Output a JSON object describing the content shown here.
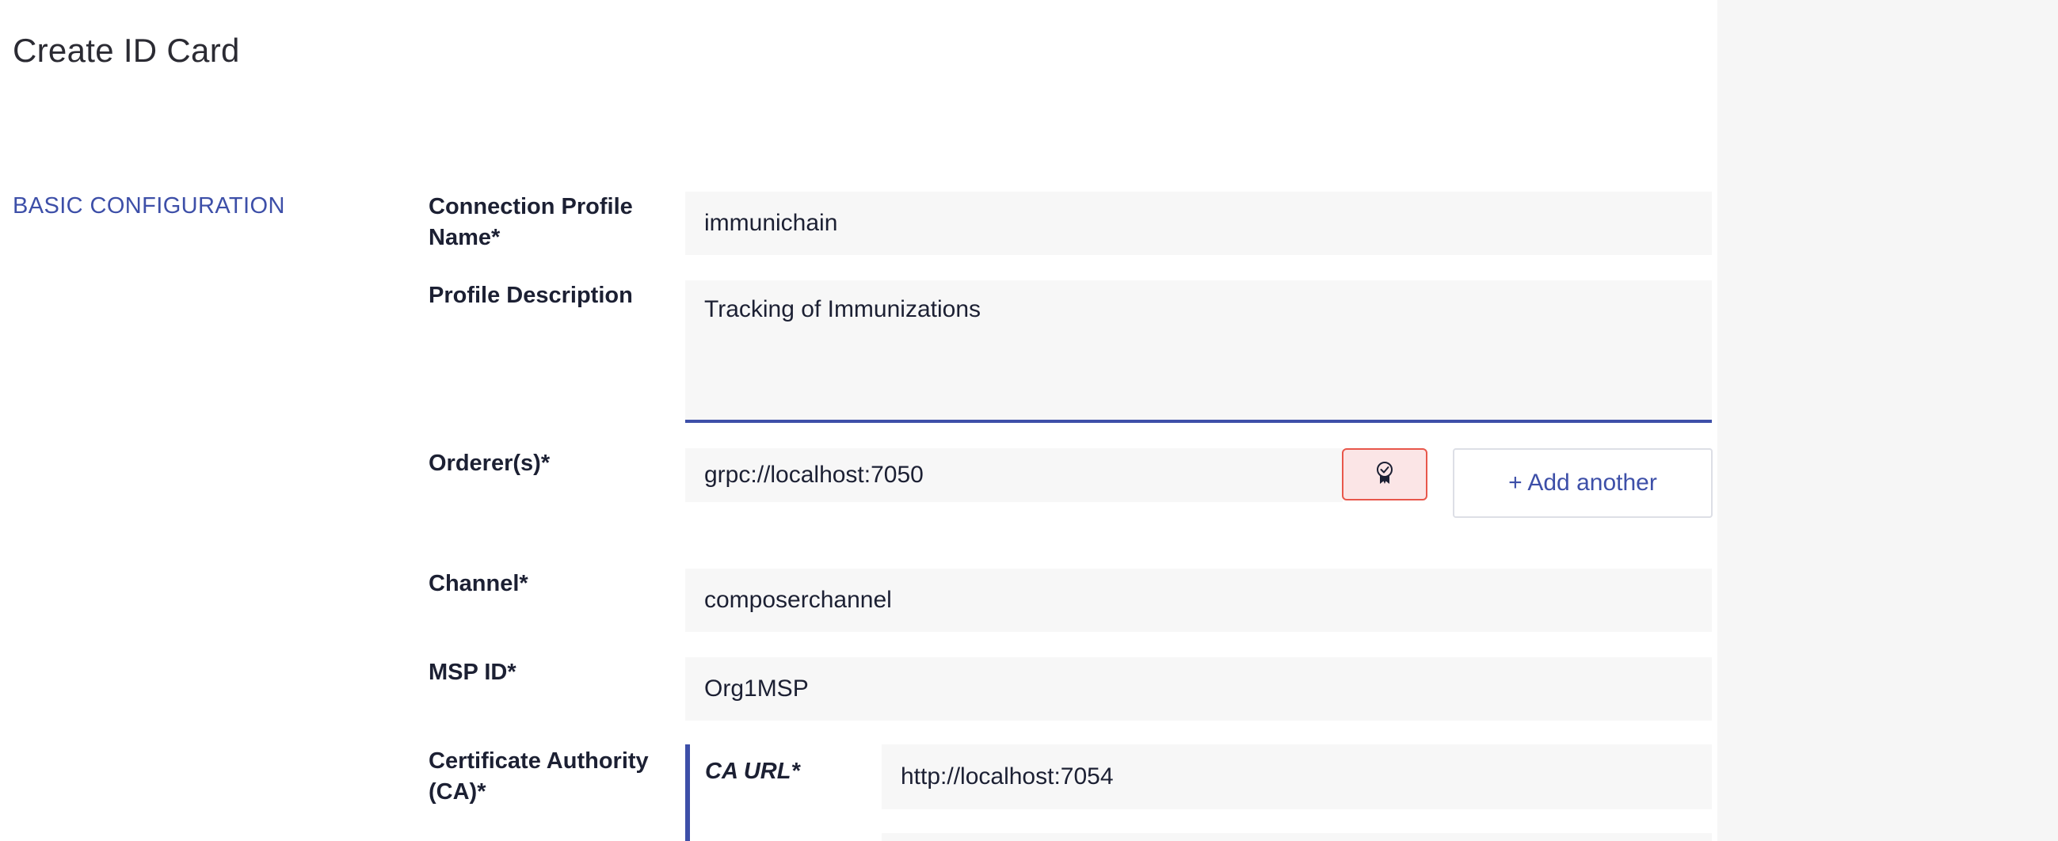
{
  "page": {
    "title": "Create ID Card"
  },
  "section": {
    "title": "BASIC CONFIGURATION"
  },
  "fields": {
    "profile_name": {
      "label": "Connection Profile Name*",
      "value": "immunichain"
    },
    "profile_description": {
      "label": "Profile Description",
      "value": "Tracking of Immunizations"
    },
    "orderers": {
      "label": "Orderer(s)*",
      "value": "grpc://localhost:7050",
      "cert_icon": "certificate-icon",
      "add_label": "+ Add another"
    },
    "channel": {
      "label": "Channel*",
      "value": "composerchannel"
    },
    "msp_id": {
      "label": "MSP ID*",
      "value": "Org1MSP"
    },
    "ca": {
      "label": "Certificate Authority (CA)*",
      "url_label": "CA URL*",
      "url_value": "http://localhost:7054"
    }
  },
  "colors": {
    "accent": "#3d4fa8",
    "error_border": "#e8574b",
    "error_bg": "#fbe5e6"
  }
}
